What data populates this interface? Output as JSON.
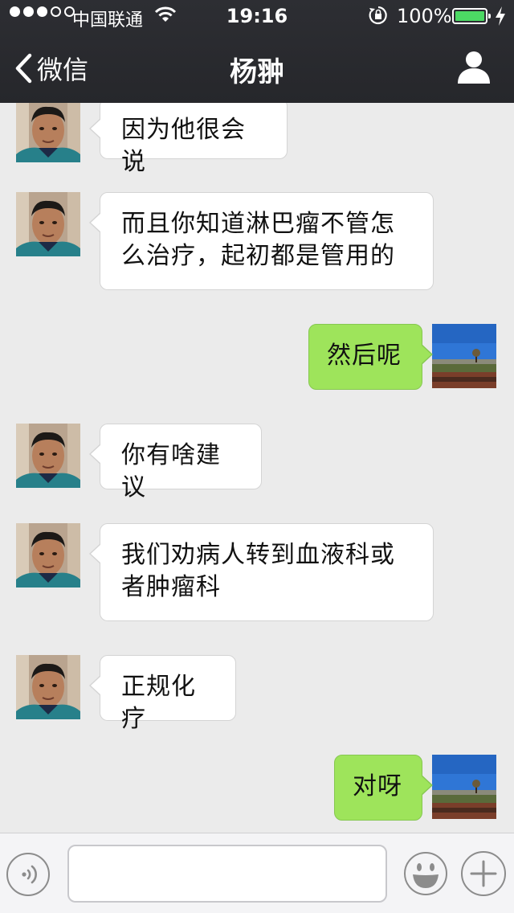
{
  "status_bar": {
    "carrier": "中国联通",
    "time": "19:16",
    "battery_percent": "100%",
    "signal_bars_filled": 3,
    "signal_bars_total": 5,
    "battery_level": 1.0,
    "charging": true
  },
  "nav": {
    "back_label": "微信",
    "title": "杨翀"
  },
  "messages": [
    {
      "side": "in",
      "text": "因为他很会说",
      "lines": [
        "因为他很会说"
      ]
    },
    {
      "side": "in",
      "text": "而且你知道淋巴瘤不管怎么治疗，起初都是管用的",
      "lines": [
        "而且你知道淋巴瘤不管怎",
        "么治疗，起初都是管用的"
      ]
    },
    {
      "side": "out",
      "text": "然后呢",
      "lines": [
        "然后呢"
      ]
    },
    {
      "side": "in",
      "text": "你有啥建议",
      "lines": [
        "你有啥建议"
      ]
    },
    {
      "side": "in",
      "text": "我们劝病人转到血液科或者肿瘤科",
      "lines": [
        "我们劝病人转到血液科或",
        "者肿瘤科"
      ]
    },
    {
      "side": "in",
      "text": "正规化疗",
      "lines": [
        "正规化疗"
      ]
    },
    {
      "side": "out",
      "text": "对呀",
      "lines": [
        "对呀"
      ]
    }
  ],
  "input_bar": {
    "text_value": ""
  },
  "icons": {
    "back": "chevron-left-icon",
    "profile": "person-icon",
    "voice": "voice-icon",
    "emoji": "emoji-icon",
    "more": "plus-icon",
    "wifi": "wifi-icon",
    "lock": "rotation-lock-icon",
    "bolt": "charging-bolt-icon"
  },
  "colors": {
    "nav_bg": "#2d2e33",
    "chat_bg": "#ebebeb",
    "incoming_bubble": "#ffffff",
    "outgoing_bubble": "#9ee45b",
    "battery_fill": "#4cd964"
  }
}
